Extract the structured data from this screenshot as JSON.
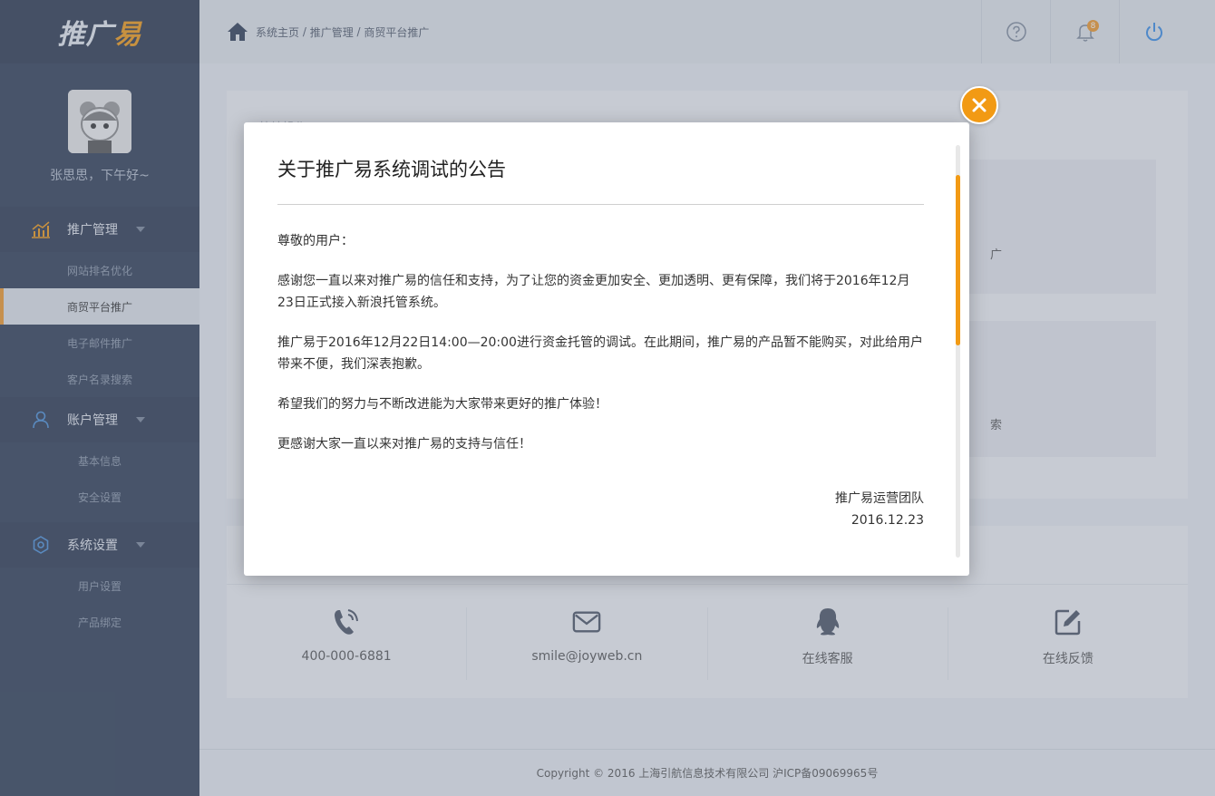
{
  "logo": {
    "part1": "推广",
    "part2": "易"
  },
  "user": {
    "greeting": "张思思，下午好~"
  },
  "sidebar": {
    "groups": [
      {
        "label": "推广管理",
        "icon": "chart-icon",
        "items": [
          {
            "label": "网站排名优化",
            "active": false
          },
          {
            "label": "商贸平台推广",
            "active": true
          },
          {
            "label": "电子邮件推广",
            "active": false
          },
          {
            "label": "客户名录搜索",
            "active": false
          }
        ]
      },
      {
        "label": "账户管理",
        "icon": "user-icon",
        "items": [
          {
            "label": "基本信息",
            "active": false
          },
          {
            "label": "安全设置",
            "active": false
          }
        ]
      },
      {
        "label": "系统设置",
        "icon": "gear-icon",
        "items": [
          {
            "label": "用户设置",
            "active": false
          },
          {
            "label": "产品绑定",
            "active": false
          }
        ]
      }
    ]
  },
  "breadcrumb": {
    "home": "系统主页",
    "sep": " / ",
    "level1": "推广管理",
    "level2": "商贸平台推广"
  },
  "topbar": {
    "notification_count": "8"
  },
  "panel": {
    "title_partial": "快捷操作",
    "card1_partial": "广",
    "card2_partial": "索"
  },
  "contacts": [
    {
      "icon": "phone-icon",
      "label": "400-000-6881"
    },
    {
      "icon": "mail-icon",
      "label": "smile@joyweb.cn"
    },
    {
      "icon": "qq-icon",
      "label": "在线客服"
    },
    {
      "icon": "edit-icon",
      "label": "在线反馈"
    }
  ],
  "footer": {
    "text": "Copyright © 2016 上海引航信息技术有限公司  沪ICP备09069965号"
  },
  "modal": {
    "title": "关于推广易系统调试的公告",
    "salutation": "尊敬的用户：",
    "para1": "感谢您一直以来对推广易的信任和支持，为了让您的资金更加安全、更加透明、更有保障，我们将于2016年12月23日正式接入新浪托管系统。",
    "para2": "推广易于2016年12月22日14:00—20:00进行资金托管的调试。在此期间，推广易的产品暂不能购买，对此给用户带来不便，我们深表抱歉。",
    "para3": "希望我们的努力与不断改进能为大家带来更好的推广体验！",
    "para4": "更感谢大家一直以来对推广易的支持与信任！",
    "signature": "推广易运营团队",
    "date": "2016.12.23"
  },
  "colors": {
    "accent": "#f29a14",
    "sidebar_bg": "#2f3d55",
    "active_item_bg": "#dfe3ea"
  }
}
